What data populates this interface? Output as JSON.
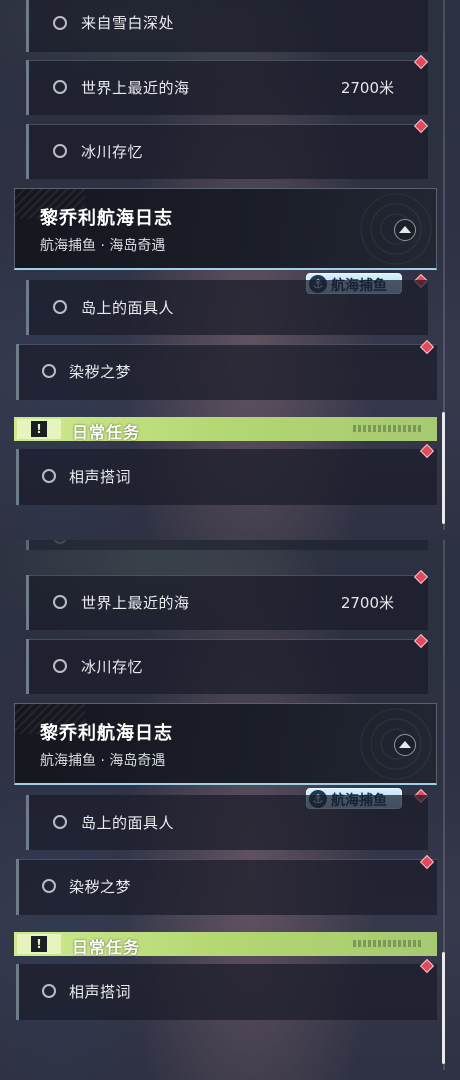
{
  "tasks_prev": [
    {
      "label": "来自雪白深处"
    },
    {
      "label": "世界上最近的海",
      "distance": "2700米"
    },
    {
      "label": "冰川存忆"
    }
  ],
  "main_quest": {
    "title": "黎乔利航海日志",
    "subtitle": "航海捕鱼 · 海岛奇遇",
    "nav_icon": "navigate-arrow-icon"
  },
  "badge": {
    "label": "航海捕鱼",
    "icon": "anchor-icon"
  },
  "quest_tasks": [
    {
      "label": "岛上的面具人"
    },
    {
      "label": "染秽之梦"
    }
  ],
  "daily": {
    "header": "日常任务",
    "icon": "exclamation-icon",
    "tasks": [
      {
        "label": "相声搭词"
      }
    ]
  },
  "colors": {
    "marker": "#e04a5b",
    "daily_header": "#b3d772",
    "main_card_accent": "#9fd0e8"
  }
}
